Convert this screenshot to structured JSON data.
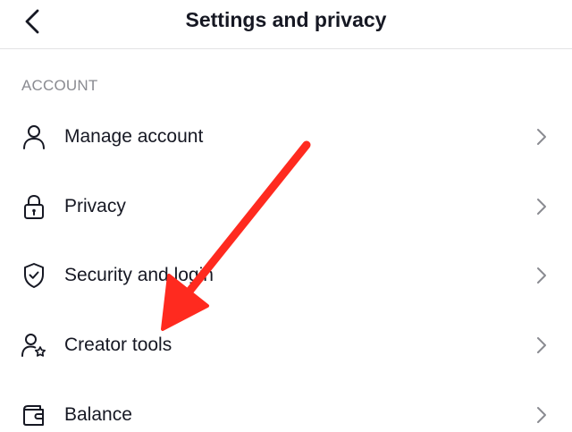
{
  "header": {
    "title": "Settings and privacy",
    "back_icon": "chevron-left-icon"
  },
  "section": {
    "label": "ACCOUNT"
  },
  "items": [
    {
      "label": "Manage account",
      "icon": "person-icon"
    },
    {
      "label": "Privacy",
      "icon": "lock-icon"
    },
    {
      "label": "Security and login",
      "icon": "shield-check-icon"
    },
    {
      "label": "Creator tools",
      "icon": "person-star-icon"
    },
    {
      "label": "Balance",
      "icon": "wallet-icon"
    }
  ],
  "annotation": {
    "arrow_color": "#ff2a1f",
    "arrow_icon": "red-arrow-icon"
  },
  "colors": {
    "text_primary": "#161823",
    "text_secondary": "#8a8b91",
    "icon": "#161823",
    "chevron": "#8a8b91",
    "divider": "#e3e3e4"
  }
}
